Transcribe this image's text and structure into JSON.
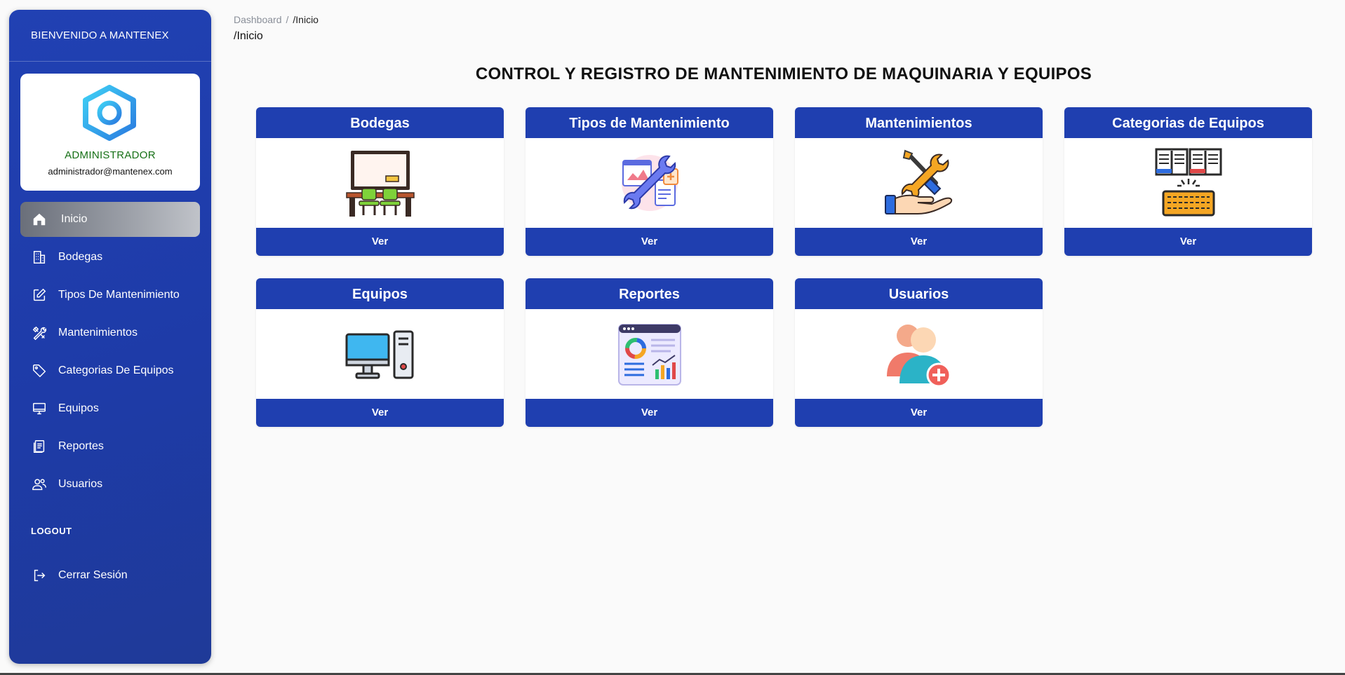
{
  "sidebar": {
    "brand": "BIENVENIDO A MANTENEX",
    "profile": {
      "role": "ADMINISTRADOR",
      "email": "administrador@mantenex.com"
    },
    "items": [
      {
        "label": "Inicio",
        "icon": "home-icon"
      },
      {
        "label": "Bodegas",
        "icon": "building-icon"
      },
      {
        "label": "Tipos De Mantenimiento",
        "icon": "edit-icon"
      },
      {
        "label": "Mantenimientos",
        "icon": "tools-icon"
      },
      {
        "label": "Categorias De Equipos",
        "icon": "tag-icon"
      },
      {
        "label": "Equipos",
        "icon": "monitor-icon"
      },
      {
        "label": "Reportes",
        "icon": "report-icon"
      },
      {
        "label": "Usuarios",
        "icon": "users-icon"
      }
    ],
    "logout_heading": "LOGOUT",
    "logout_label": "Cerrar Sesión"
  },
  "breadcrumb": {
    "root": "Dashboard",
    "separator": "/",
    "current": "/Inicio",
    "title": "/Inicio"
  },
  "main": {
    "title": "CONTROL Y REGISTRO DE MANTENIMIENTO DE MAQUINARIA Y EQUIPOS",
    "cards": [
      {
        "title": "Bodegas",
        "button": "Ver",
        "icon": "warehouse-desk-icon"
      },
      {
        "title": "Tipos de Mantenimiento",
        "button": "Ver",
        "icon": "wrench-documents-icon"
      },
      {
        "title": "Mantenimientos",
        "button": "Ver",
        "icon": "hand-tools-icon"
      },
      {
        "title": "Categorias de Equipos",
        "button": "Ver",
        "icon": "categories-keyboard-icon"
      },
      {
        "title": "Equipos",
        "button": "Ver",
        "icon": "computer-icon"
      },
      {
        "title": "Reportes",
        "button": "Ver",
        "icon": "dashboard-report-icon"
      },
      {
        "title": "Usuarios",
        "button": "Ver",
        "icon": "add-user-icon"
      }
    ]
  },
  "colors": {
    "primary": "#1f3fb0",
    "sidebar": "#2141b3",
    "role": "#167016",
    "background": "#fafafa"
  }
}
